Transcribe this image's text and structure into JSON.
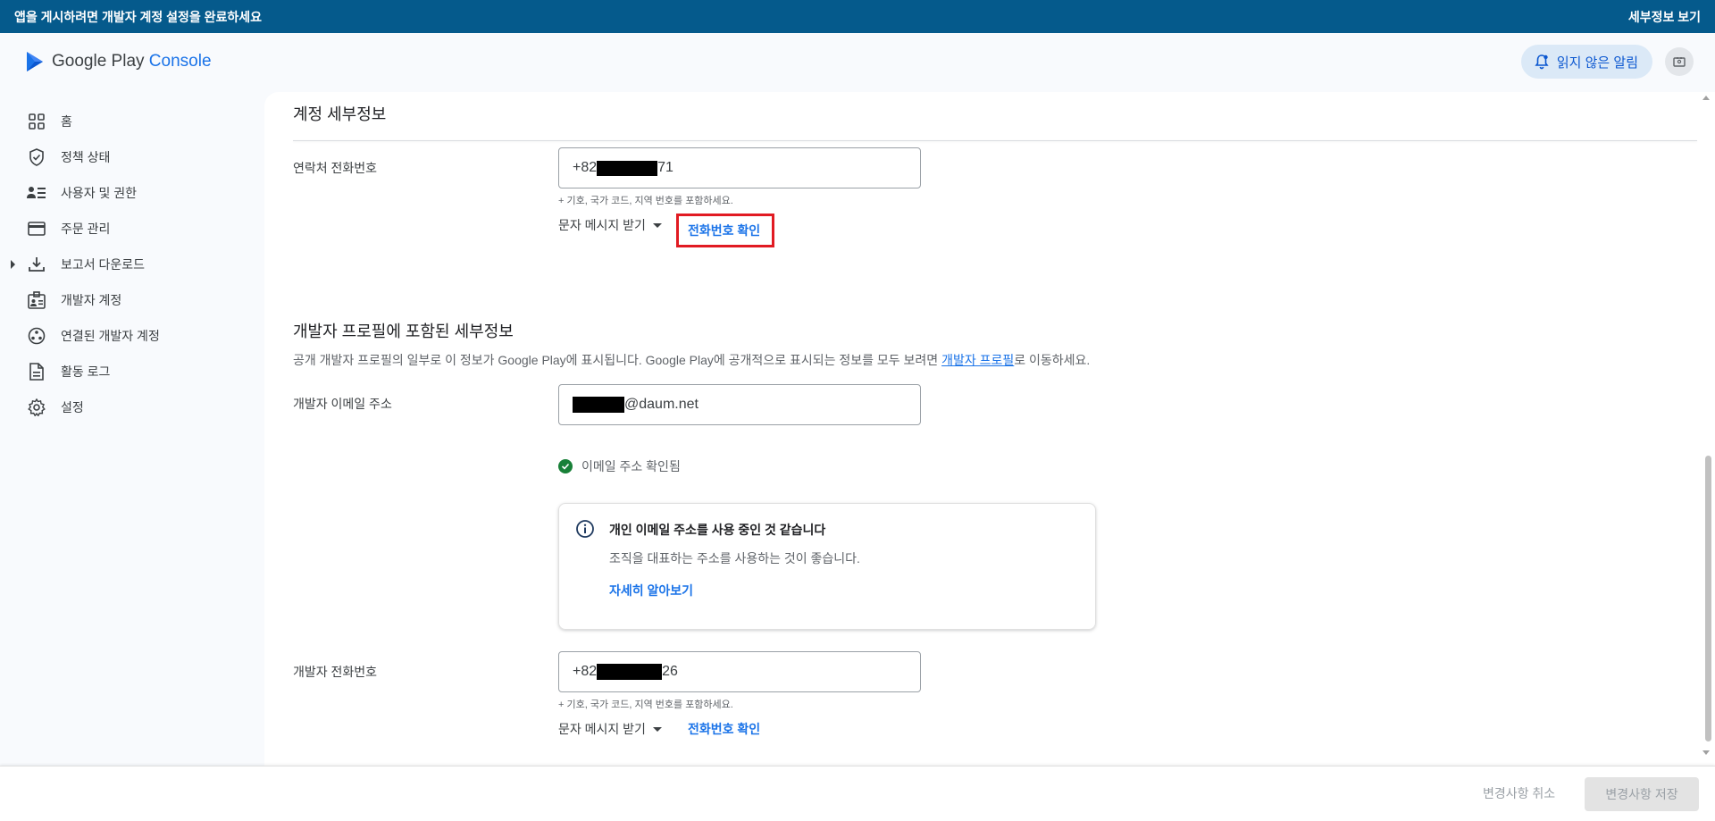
{
  "banner": {
    "message": "앱을 게시하려면 개발자 계정 설정을 완료하세요",
    "link": "세부정보 보기"
  },
  "header": {
    "logo_text": "Google Play",
    "logo_console": "Console",
    "alerts_label": "읽지 않은 알림"
  },
  "sidebar": {
    "items": [
      {
        "label": "홈",
        "icon": "dashboard-grid-icon"
      },
      {
        "label": "정책 상태",
        "icon": "shield-icon"
      },
      {
        "label": "사용자 및 권한",
        "icon": "users-list-icon"
      },
      {
        "label": "주문 관리",
        "icon": "credit-card-icon"
      },
      {
        "label": "보고서 다운로드",
        "icon": "download-icon"
      },
      {
        "label": "개발자 계정",
        "icon": "id-badge-icon"
      },
      {
        "label": "연결된 개발자 계정",
        "icon": "linked-accounts-icon"
      },
      {
        "label": "활동 로그",
        "icon": "document-icon"
      },
      {
        "label": "설정",
        "icon": "gear-icon"
      }
    ]
  },
  "account": {
    "title": "계정 세부정보",
    "contact_phone_label": "연락처 전화번호",
    "contact_phone_prefix": "+82",
    "contact_phone_suffix": "71",
    "phone_hint": "+ 기호, 국가 코드, 지역 번호를 포함하세요.",
    "sms_select": "문자 메시지 받기",
    "verify_phone": "전화번호 확인"
  },
  "profile": {
    "title": "개발자 프로필에 포함된 세부정보",
    "desc_before": "공개 개발자 프로필의 일부로 이 정보가 Google Play에 표시됩니다. Google Play에 공개적으로 표시되는 정보를 모두 보려면 ",
    "desc_link": "개발자 프로필",
    "desc_after": "로 이동하세요.",
    "email_label": "개발자 이메일 주소",
    "email_suffix": "@daum.net",
    "email_verified": "이메일 주소 확인됨",
    "info_title": "개인 이메일 주소를 사용 중인 것 같습니다",
    "info_body": "조직을 대표하는 주소를 사용하는 것이 좋습니다.",
    "info_link": "자세히 알아보기",
    "dev_phone_label": "개발자 전화번호",
    "dev_phone_prefix": "+82",
    "dev_phone_suffix": "26",
    "phone_hint": "+ 기호, 국가 코드, 지역 번호를 포함하세요.",
    "sms_select": "문자 메시지 받기",
    "verify_phone": "전화번호 확인"
  },
  "footer": {
    "cancel": "변경사항 취소",
    "save": "변경사항 저장"
  },
  "colors": {
    "banner": "#055a8c",
    "accent": "#1a73e8",
    "highlight_box": "#e11b22",
    "verified": "#188038"
  }
}
